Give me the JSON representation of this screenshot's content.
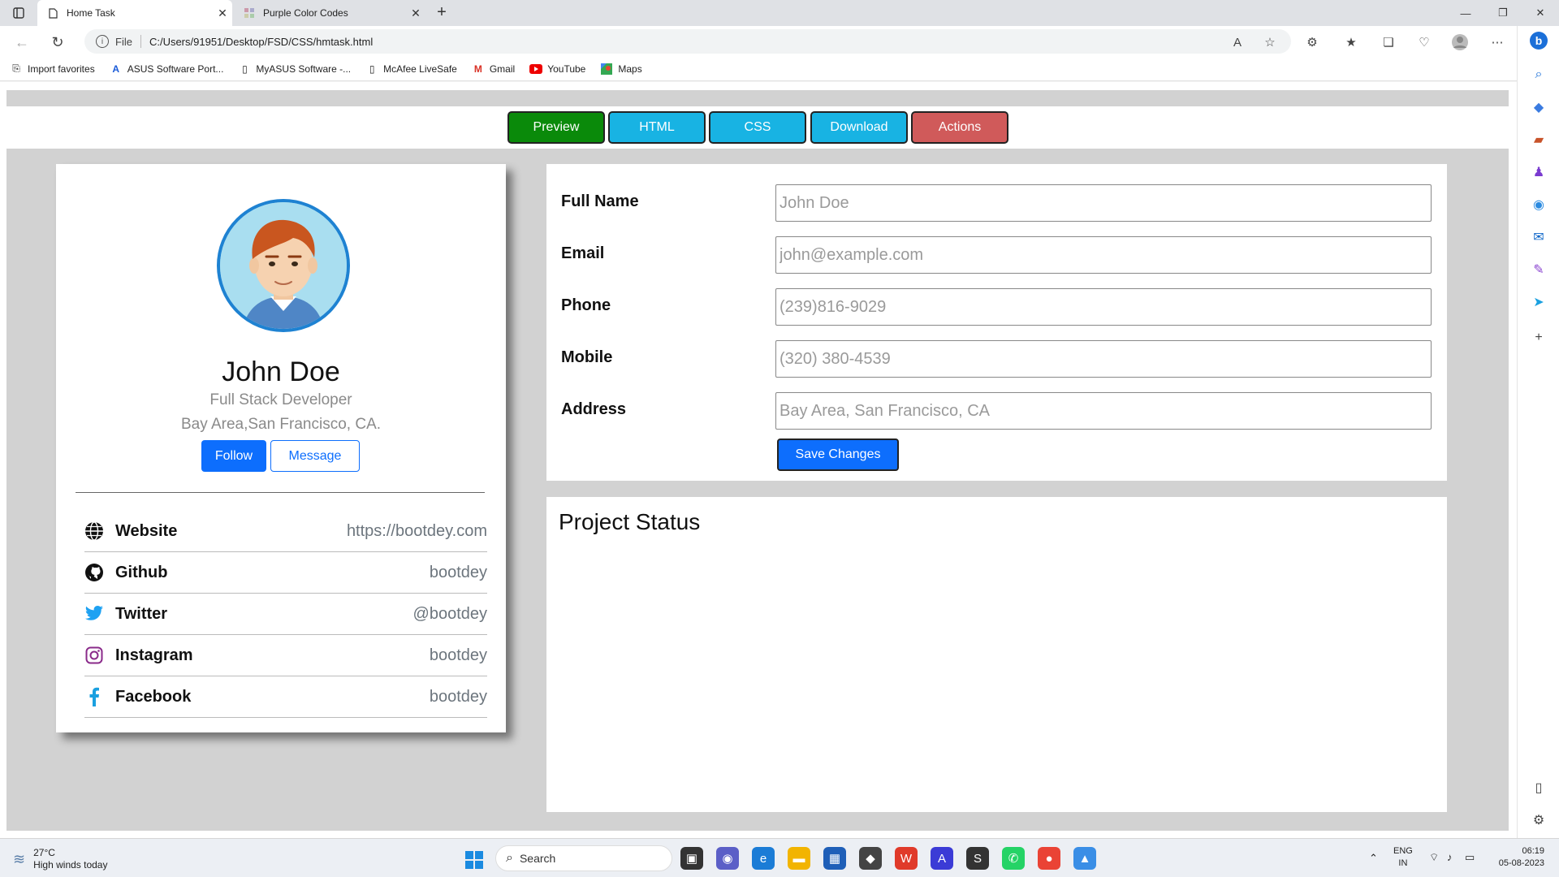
{
  "browser": {
    "tabs": [
      {
        "title": "Home Task",
        "active": true
      },
      {
        "title": "Purple Color Codes",
        "active": false
      }
    ],
    "address": {
      "scheme_label": "File",
      "url": "C:/Users/91951/Desktop/FSD/CSS/hmtask.html"
    },
    "favorites": [
      {
        "label": "Import favorites",
        "icon": "import-icon"
      },
      {
        "label": "ASUS Software Port...",
        "icon": "asus-icon"
      },
      {
        "label": "MyASUS Software -...",
        "icon": "page-icon"
      },
      {
        "label": "McAfee LiveSafe",
        "icon": "page-icon"
      },
      {
        "label": "Gmail",
        "icon": "gmail-icon"
      },
      {
        "label": "YouTube",
        "icon": "youtube-icon"
      },
      {
        "label": "Maps",
        "icon": "maps-icon"
      }
    ]
  },
  "page": {
    "nav_buttons": [
      {
        "label": "Preview",
        "color": "#0a8a0a"
      },
      {
        "label": "HTML",
        "color": "#18b3e3"
      },
      {
        "label": "CSS",
        "color": "#18b3e3"
      },
      {
        "label": "Download",
        "color": "#18b3e3"
      },
      {
        "label": "Actions",
        "color": "#d05a5a"
      }
    ],
    "profile": {
      "name": "John Doe",
      "title": "Full Stack Developer",
      "location": "Bay Area,San Francisco, CA.",
      "follow_label": "Follow",
      "message_label": "Message"
    },
    "social": [
      {
        "label": "Website",
        "value": "https://bootdey.com",
        "icon": "globe-icon"
      },
      {
        "label": "Github",
        "value": "bootdey",
        "icon": "github-icon"
      },
      {
        "label": "Twitter",
        "value": "@bootdey",
        "icon": "twitter-icon"
      },
      {
        "label": "Instagram",
        "value": "bootdey",
        "icon": "instagram-icon"
      },
      {
        "label": "Facebook",
        "value": "bootdey",
        "icon": "facebook-icon"
      }
    ],
    "form": {
      "fields": [
        {
          "label": "Full Name",
          "placeholder": "John Doe"
        },
        {
          "label": "Email",
          "placeholder": "john@example.com"
        },
        {
          "label": "Phone",
          "placeholder": "(239)816-9029"
        },
        {
          "label": "Mobile",
          "placeholder": "(320) 380-4539"
        },
        {
          "label": "Address",
          "placeholder": "Bay Area, San Francisco, CA"
        }
      ],
      "save_label": "Save Changes"
    },
    "project": {
      "title": "Project Status"
    }
  },
  "taskbar": {
    "weather": {
      "temp": "27°C",
      "desc": "High winds today"
    },
    "search_placeholder": "Search",
    "lang": {
      "line1": "ENG",
      "line2": "IN"
    },
    "clock": {
      "time": "06:19",
      "date": "05-08-2023"
    }
  }
}
